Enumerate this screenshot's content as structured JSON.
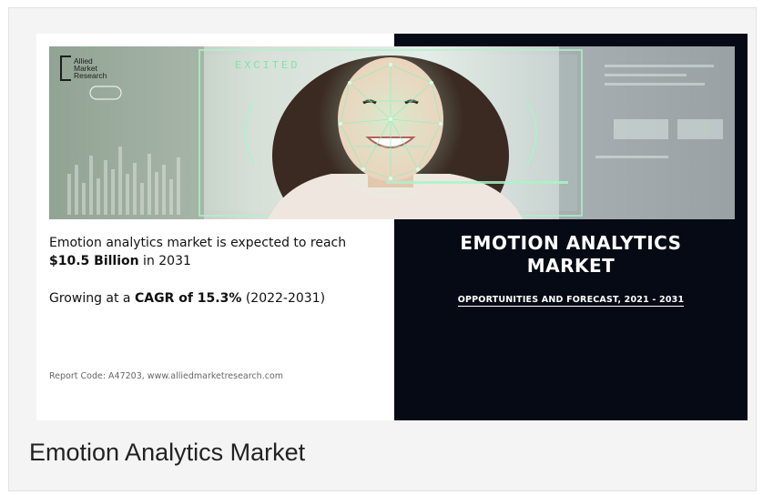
{
  "infographic": {
    "logo_lines": [
      "Allied",
      "Market",
      "Research"
    ],
    "banner_tag": "EXCITED",
    "lead_prefix": "Emotion analytics market is expected to reach ",
    "lead_value": "$10.5 Billion",
    "lead_suffix": " in 2031",
    "growth_prefix": "Growing at a ",
    "growth_value": "CAGR of 15.3%",
    "growth_suffix": " (2022-2031)",
    "report_code": "Report Code: A47203, www.alliedmarketresearch.com",
    "title_line1": "EMOTION ANALYTICS",
    "title_line2": "MARKET",
    "subtitle": "OPPORTUNITIES AND FORECAST, 2021 - 2031"
  },
  "caption": "Emotion Analytics Market",
  "colors": {
    "dark_panel": "#060a14",
    "face_mesh": "#8ff0c0",
    "card_bg": "#f4f4f4"
  }
}
